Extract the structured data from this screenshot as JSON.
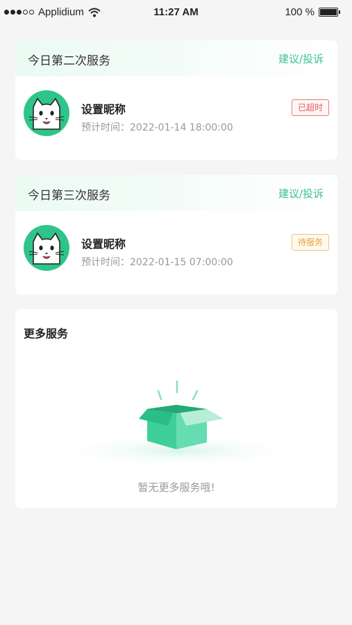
{
  "status_bar": {
    "carrier": "Applidium",
    "time": "11:27 AM",
    "battery": "100 %"
  },
  "services": [
    {
      "title": "今日第二次服务",
      "link": "建议/投诉",
      "name": "设置昵称",
      "time": "预计时间：2022-01-14 18:00:00",
      "badge": "已超时"
    },
    {
      "title": "今日第三次服务",
      "link": "建议/投诉",
      "name": "设置昵称",
      "time": "预计时间：2022-01-15 07:00:00",
      "badge": "待服务"
    }
  ],
  "more": {
    "title": "更多服务",
    "empty_text": "暂无更多服务哦!"
  },
  "colors": {
    "accent": "#3cc195",
    "overtime": "#e05c5c",
    "waiting": "#e6a23c"
  }
}
